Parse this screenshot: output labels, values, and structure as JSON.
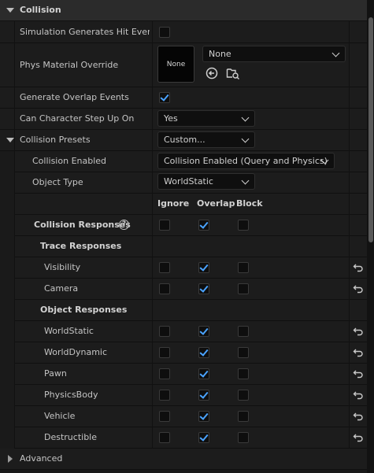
{
  "section": {
    "title": "Collision",
    "expanded": true
  },
  "rows": {
    "hit_events": {
      "label": "Simulation Generates Hit Even...",
      "checked": false
    },
    "phys_material": {
      "label": "Phys Material Override",
      "thumb_text": "None",
      "value": "None"
    },
    "overlap_events": {
      "label": "Generate Overlap Events",
      "checked": true
    },
    "step_up": {
      "label": "Can Character Step Up On",
      "value": "Yes"
    },
    "presets": {
      "label": "Collision Presets",
      "value": "Custom..."
    },
    "collision_enabled": {
      "label": "Collision Enabled",
      "value": "Collision Enabled (Query and Physics)"
    },
    "object_type": {
      "label": "Object Type",
      "value": "WorldStatic"
    }
  },
  "response_headers": {
    "ignore": "Ignore",
    "overlap": "Overlap",
    "block": "Block"
  },
  "collision_responses": {
    "label": "Collision Responses",
    "help": "?",
    "ignore": false,
    "overlap": true,
    "block": false
  },
  "trace_responses": {
    "title": "Trace Responses",
    "items": [
      {
        "label": "Visibility",
        "ignore": false,
        "overlap": true,
        "block": false
      },
      {
        "label": "Camera",
        "ignore": false,
        "overlap": true,
        "block": false
      }
    ]
  },
  "object_responses": {
    "title": "Object Responses",
    "items": [
      {
        "label": "WorldStatic",
        "ignore": false,
        "overlap": true,
        "block": false
      },
      {
        "label": "WorldDynamic",
        "ignore": false,
        "overlap": true,
        "block": false
      },
      {
        "label": "Pawn",
        "ignore": false,
        "overlap": true,
        "block": false
      },
      {
        "label": "PhysicsBody",
        "ignore": false,
        "overlap": true,
        "block": false
      },
      {
        "label": "Vehicle",
        "ignore": false,
        "overlap": true,
        "block": false
      },
      {
        "label": "Destructible",
        "ignore": false,
        "overlap": true,
        "block": false
      }
    ]
  },
  "advanced": {
    "label": "Advanced",
    "expanded": false
  },
  "icons": {
    "section_toggle": "chevron-down-icon",
    "browse": "arrow-left-circle-icon",
    "find": "folder-search-icon",
    "reset": "reset-arrow-icon",
    "advanced_toggle": "chevron-right-icon"
  },
  "colors": {
    "accent": "#4aa3ff",
    "background": "#1a1a1a",
    "header": "#2b2b2b"
  }
}
